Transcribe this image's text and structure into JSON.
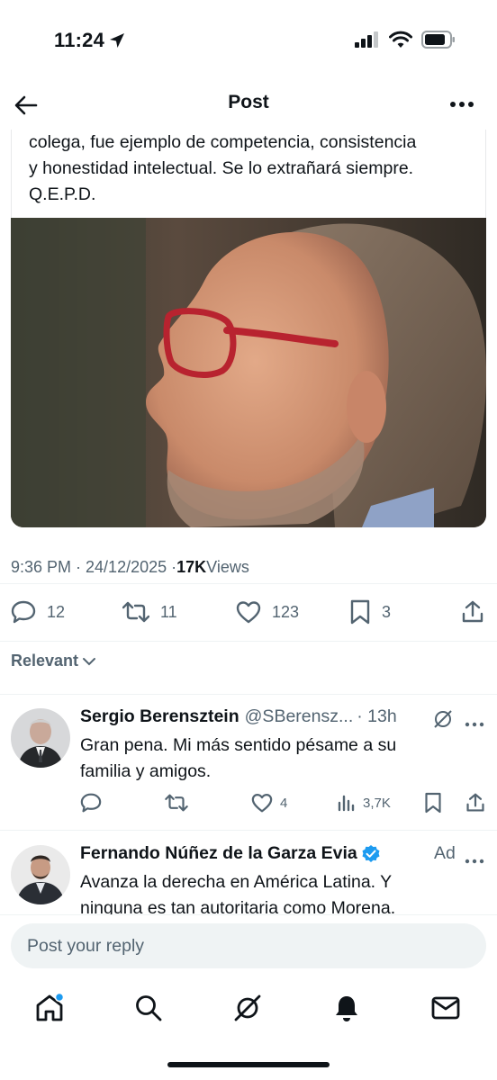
{
  "status_bar": {
    "time": "11:24"
  },
  "header": {
    "title": "Post"
  },
  "post": {
    "text_lines": [
      "colega, fue ejemplo de competencia, consistencia",
      "y honestidad intelectual. Se lo extrañará siempre.",
      "Q.E.P.D."
    ],
    "timestamp": "9:36 PM · 24/12/2025 · ",
    "views_count": "17K",
    "views_label": " Views",
    "replies": "12",
    "reposts": "11",
    "likes": "123",
    "bookmarks": "3"
  },
  "sort": {
    "label": "Relevant"
  },
  "replies": [
    {
      "name": "Sergio Berensztein",
      "handle": "@SBerensz...",
      "time": "· 13h",
      "text_lines": [
        "Gran pena. Mi más sentido pésame a su",
        "familia y amigos."
      ],
      "likes": "4",
      "views": "3,7K"
    },
    {
      "name": "Fernando Núñez de la Garza Evia",
      "ad_label": "Ad",
      "text_lines": [
        "Avanza la derecha en América Latina. Y",
        "ninguna es tan autoritaria como Morena."
      ]
    }
  ],
  "reply_box": {
    "placeholder": "Post your reply"
  },
  "colors": {
    "text": "#0f1419",
    "muted": "#536471",
    "accent": "#1d9bf0",
    "divider": "#eff3f4"
  },
  "icons": [
    "back-arrow-icon",
    "more-icon",
    "reply-icon",
    "repost-icon",
    "like-icon",
    "bookmark-icon",
    "share-icon",
    "grok-icon",
    "views-icon",
    "verified-icon",
    "home-icon",
    "search-icon",
    "bell-icon",
    "mail-icon"
  ]
}
